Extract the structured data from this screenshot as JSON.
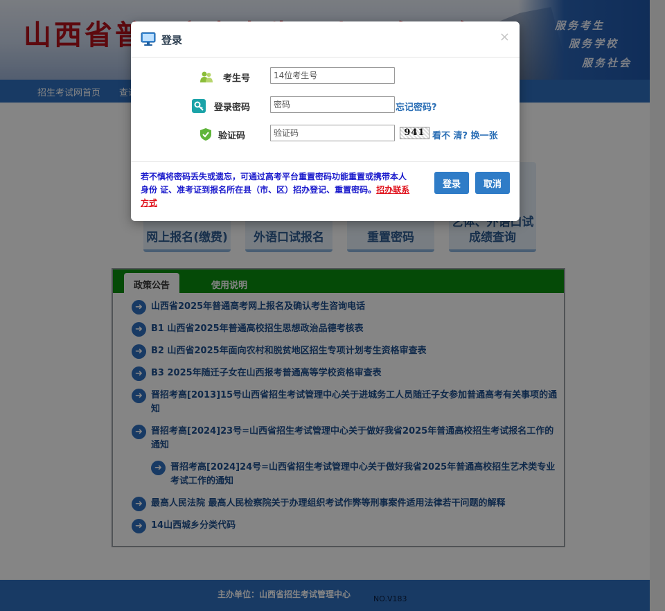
{
  "header": {
    "site_title": "山西省普通高考考生网上服务平台",
    "slogans": [
      "服务考生",
      "服务学校",
      "服务社会"
    ]
  },
  "nav": {
    "items": [
      "招生考试网首页",
      "查询"
    ]
  },
  "tiles": [
    {
      "label": "网上报名(缴费)"
    },
    {
      "label": "外语口试报名"
    },
    {
      "label": "重置密码"
    },
    {
      "label": "艺体、外语口试\n成绩查询"
    }
  ],
  "notice": {
    "tabs": [
      "政策公告",
      "使用说明"
    ],
    "items": [
      "山西省2025年普通高考网上报名及确认考生咨询电话",
      "B1 山西省2025年普通高校招生思想政治品德考核表",
      "B2 山西省2025年面向农村和脱贫地区招生专项计划考生资格审查表",
      "B3 2025年随迁子女在山西报考普通高等学校资格审查表",
      "晋招考高[2013]15号山西省招生考试管理中心关于进城务工人员随迁子女参加普通高考有关事项的通知",
      "晋招考高[2024]23号=山西省招生考试管理中心关于做好我省2025年普通高校招生考试报名工作的通知",
      "晋招考高[2024]24号=山西省招生考试管理中心关于做好我省2025年普通高校招生艺术类专业考试工作的通知",
      "最高人民法院 最高人民检察院关于办理组织考试作弊等刑事案件适用法律若干问题的解释",
      "14山西城乡分类代码"
    ]
  },
  "footer": {
    "sponsor": "主办单位：山西省招生考试管理中心",
    "version": "NO.V183"
  },
  "modal": {
    "title": "登录",
    "close": "×",
    "examinee_label": "考生号",
    "examinee_placeholder": "14位考生号",
    "password_label": "登录密码",
    "password_placeholder": "密码",
    "forgot_password": "忘记密码?",
    "captcha_label": "验证码",
    "captcha_placeholder": "验证码",
    "captcha_value": "941",
    "refresh_captcha": "看不 清? 换一张",
    "note": "若不慎将密码丢失或遗忘，可通过高考平台重置密码功能重置或携带本人身份 证、准考证到报名所在县（市、区）招办登记、重置密码。",
    "note_link": "招办联系方式",
    "login_button": "登录",
    "cancel_button": "取消"
  },
  "colors": {
    "primary_blue": "#2f6fc0",
    "tab_green": "#0a8f0f",
    "title_red": "#b3121b",
    "note_blue": "#1a1acc",
    "link_red": "#e0141e"
  }
}
